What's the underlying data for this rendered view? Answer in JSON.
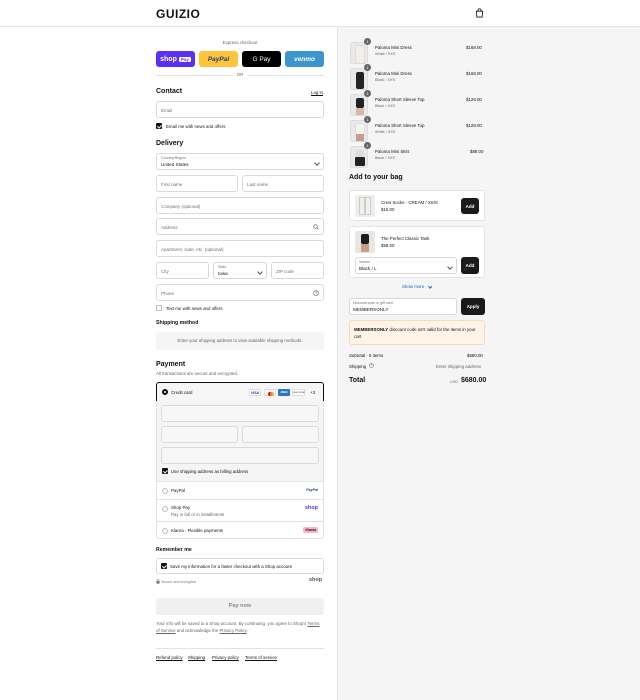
{
  "header": {
    "brand": "GUIZIO"
  },
  "express": {
    "label": "Express checkout",
    "buttons": {
      "shop": "shop",
      "shop_pay": "Pay",
      "paypal": "PayPal",
      "gpay": "G Pay",
      "venmo": "venmo"
    },
    "or": "OR"
  },
  "contact": {
    "title": "Contact",
    "login": "Log in",
    "email_placeholder": "Email",
    "news_label": "Email me with news and offers",
    "news_checked": true
  },
  "delivery": {
    "title": "Delivery",
    "country_label": "Country/Region",
    "country_value": "United States",
    "first_name": "First name",
    "last_name": "Last name",
    "company": "Company (optional)",
    "address": "Address",
    "apartment": "Apartment, suite, etc. (optional)",
    "city": "City",
    "state_label": "State",
    "state_value": "Iowa",
    "zip": "ZIP code",
    "phone": "Phone",
    "text_label": "Text me with news and offers",
    "text_checked": false
  },
  "shipping_method": {
    "title": "Shipping method",
    "placeholder": "Enter your shipping address to view available shipping methods."
  },
  "payment": {
    "title": "Payment",
    "subtitle": "All transactions are secure and encrypted.",
    "credit_card": "Credit card",
    "card_more": "+3",
    "card_brands": {
      "visa": "VISA",
      "amex": "AMEX",
      "discover": "DISCOVER"
    },
    "billing_label": "Use shipping address as billing address",
    "billing_checked": true,
    "paypal": "PayPal",
    "paypal_logo": "PayPal",
    "shop_pay": "Shop Pay",
    "shop_pay_sub": "Pay in full or in installments",
    "shop_logo": "shop",
    "klarna": "Klarna - Flexible payments",
    "klarna_logo": "Klarna"
  },
  "remember": {
    "title": "Remember me",
    "save_label": "Save my information for a faster checkout with a Shop account",
    "save_checked": true,
    "secure": "Secure and encrypted",
    "shop_logo": "shop"
  },
  "pay_now": "Pay now",
  "legal": {
    "text_a": "Your info will be saved to a Shop account. By continuing, you agree to Shop's",
    "tos": "Terms of Service",
    "text_b": "and acknowledge the",
    "privacy": "Privacy Policy",
    "text_c": "."
  },
  "footer_links": [
    "Refund policy",
    "Shipping",
    "Privacy policy",
    "Terms of service"
  ],
  "cart": {
    "items": [
      {
        "name": "Paloma Mini Dress",
        "variant": "White / XXS",
        "price": "$168.00",
        "qty": "1"
      },
      {
        "name": "Paloma Mini Dress",
        "variant": "Black / XXS",
        "price": "$168.00",
        "qty": "1"
      },
      {
        "name": "Paloma Short Sleeve Top",
        "variant": "Black / XXS",
        "price": "$128.00",
        "qty": "1"
      },
      {
        "name": "Paloma Short Sleeve Top",
        "variant": "White / XXS",
        "price": "$128.00",
        "qty": "1"
      },
      {
        "name": "Paloma Mini Skirt",
        "variant": "Black / XXS",
        "price": "$88.00",
        "qty": "1"
      }
    ]
  },
  "upsell": {
    "title": "Add to your bag",
    "product1": {
      "name": "Crew Socks - CREAM / XS/S",
      "price": "$15.00",
      "button": "Add"
    },
    "product2": {
      "name": "The Perfect Classic Tank",
      "price": "$58.00",
      "variant_label": "Variant",
      "variant_value": "Black / L",
      "button": "Add"
    },
    "show_more": "Show more"
  },
  "discount": {
    "label": "Discount code or gift card",
    "value": "MEMBERSONLY",
    "apply": "Apply",
    "error_code": "MEMBERSONLY",
    "error_text": "discount code isn't valid for the items in your cart"
  },
  "summary": {
    "subtotal_label": "Subtotal · 5 items",
    "subtotal_value": "$680.00",
    "shipping_label": "Shipping",
    "shipping_value": "Enter shipping address",
    "total_label": "Total",
    "currency": "USD",
    "total_value": "$680.00"
  },
  "colors": {
    "shop_purple": "#5a31f4",
    "paypal_yellow": "#ffc439",
    "venmo_blue": "#3d95ce",
    "error_bg": "#fff4e5"
  }
}
